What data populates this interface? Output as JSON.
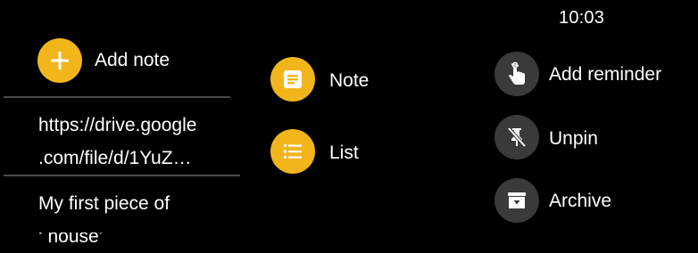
{
  "status_bar": {
    "time": "10:03"
  },
  "left_panel": {
    "add_note_label": "Add note",
    "notes": [
      {
        "lines": [
          "https://drive.google",
          ".com/file/d/1YuZ…"
        ]
      },
      {
        "lines": [
          "My first piece of",
          "‘ house’"
        ]
      }
    ]
  },
  "middle_panel": {
    "note_label": "Note",
    "list_label": "List"
  },
  "right_panel": {
    "add_reminder_label": "Add reminder",
    "unpin_label": "Unpin",
    "archive_label": "Archive"
  },
  "colors": {
    "accent": "#f2b51b",
    "action_circle": "#3a3a3a",
    "background": "#000000"
  }
}
